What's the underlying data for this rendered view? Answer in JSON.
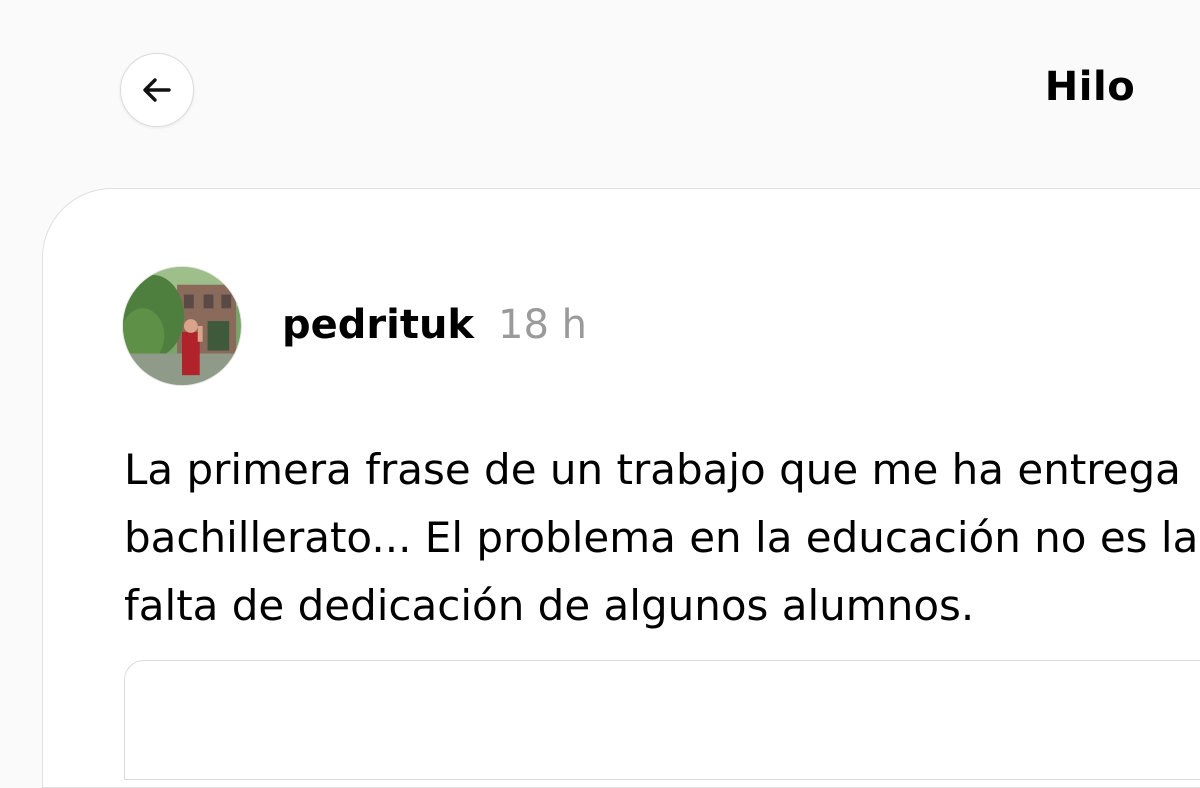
{
  "header": {
    "back_icon": "arrow-left-icon",
    "title": "Hilo"
  },
  "post": {
    "author": {
      "username": "pedrituk",
      "avatar_icon": "profile-photo"
    },
    "timestamp": "18 h",
    "text_lines": [
      "La primera frase de un trabajo que me ha entrega",
      "bachillerato... El problema en la educación no es la",
      "falta de dedicación de algunos alumnos."
    ]
  }
}
